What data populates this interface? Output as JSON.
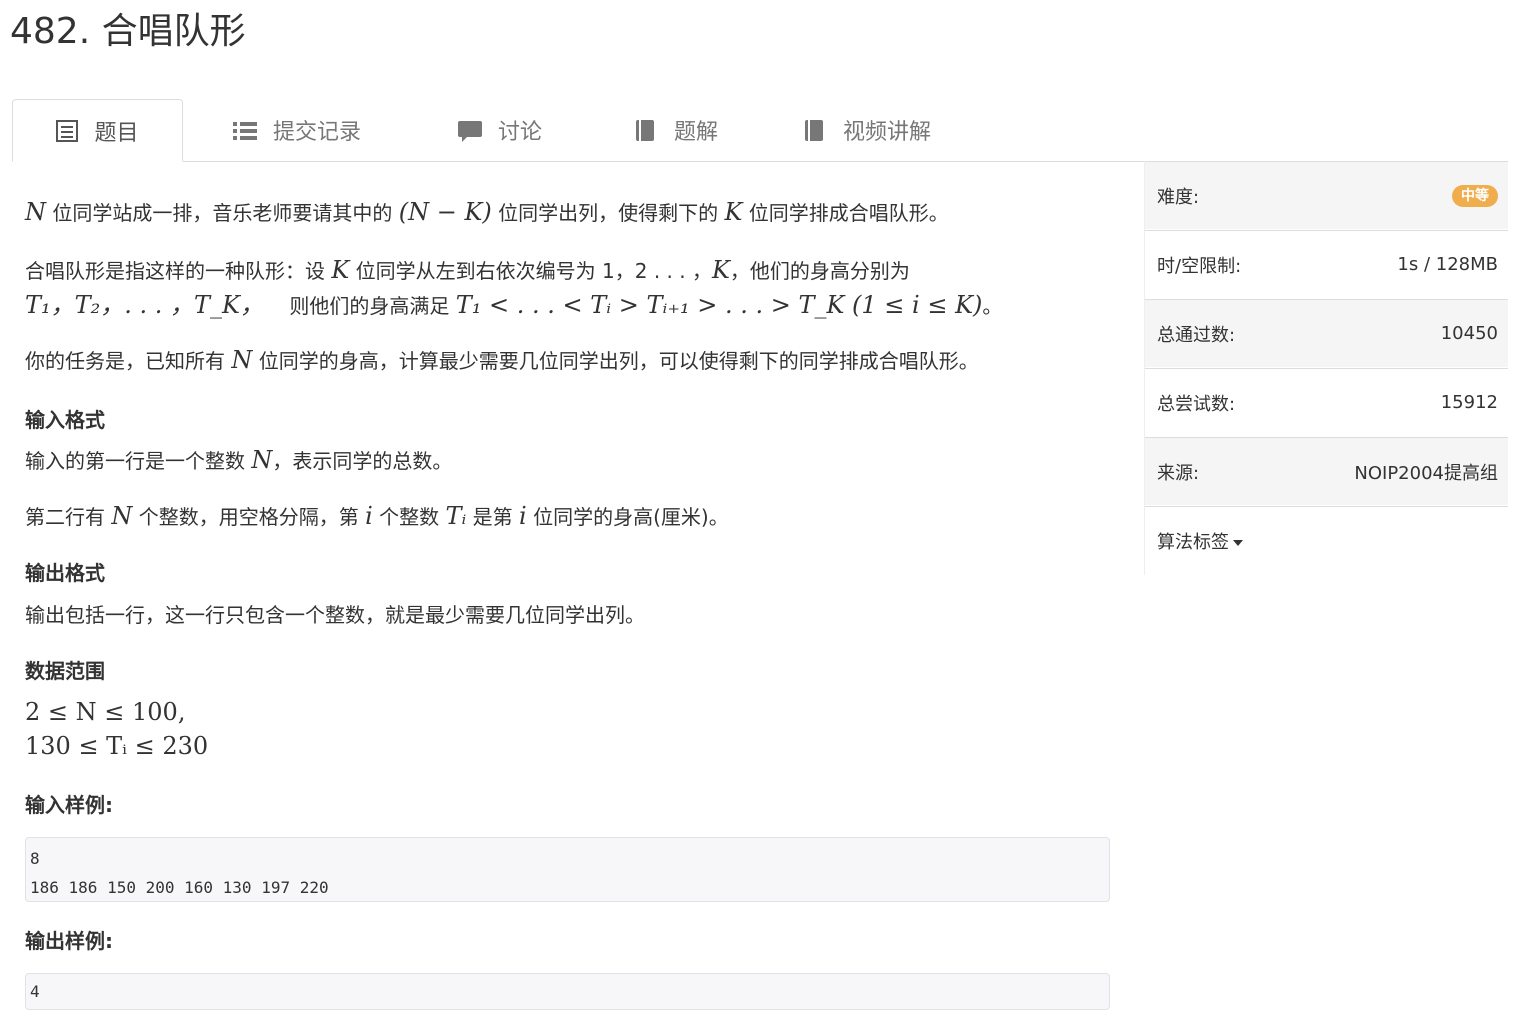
{
  "title": "482. 合唱队形",
  "tabs": [
    {
      "label": "题目",
      "icon": "document-icon",
      "active": true
    },
    {
      "label": "提交记录",
      "icon": "list-icon"
    },
    {
      "label": "讨论",
      "icon": "comment-icon"
    },
    {
      "label": "题解",
      "icon": "book-icon"
    },
    {
      "label": "视频讲解",
      "icon": "book-icon"
    }
  ],
  "problem": {
    "p1_a": "N",
    "p1_b": " 位同学站成一排，音乐老师要请其中的 ",
    "p1_c": "(N − K)",
    "p1_d": " 位同学出列，使得剩下的 ",
    "p1_e": "K",
    "p1_f": " 位同学排成合唱队形。",
    "p2_a": "合唱队形是指这样的一种队形：设 ",
    "p2_b": "K",
    "p2_c": " 位同学从左到右依次编号为 1，2 . . . ，",
    "p2_d": "K",
    "p2_e": "，他们的身高分别为",
    "p2_f": "T₁，T₂，. . . ，T_K，",
    "p2_g": "则他们的身高满足 ",
    "p2_h": "T₁ < . . . < Tᵢ > Tᵢ₊₁ > . . . > T_K (1 ≤ i ≤ K)",
    "p2_i": "。",
    "p3_a": "你的任务是，已知所有 ",
    "p3_b": "N",
    "p3_c": " 位同学的身高，计算最少需要几位同学出列，可以使得剩下的同学排成合唱队形。",
    "input_heading": "输入格式",
    "input_l1_a": "输入的第一行是一个整数 ",
    "input_l1_b": "N",
    "input_l1_c": "，表示同学的总数。",
    "input_l2_a": "第二行有 ",
    "input_l2_b": "N",
    "input_l2_c": " 个整数，用空格分隔，第 ",
    "input_l2_d": "i",
    "input_l2_e": " 个整数 ",
    "input_l2_f": "Tᵢ",
    "input_l2_g": " 是第 ",
    "input_l2_h": "i",
    "input_l2_i": " 位同学的身高(厘米)。",
    "output_heading": "输出格式",
    "output_text": "输出包括一行，这一行只包含一个整数，就是最少需要几位同学出列。",
    "range_heading": "数据范围",
    "range_1": "2 ≤ N ≤ 100,",
    "range_2": "130 ≤ Tᵢ ≤ 230",
    "sample_in_heading": "输入样例:",
    "sample_in": "8\n186 186 150 200 160 130 197 220",
    "sample_out_heading": "输出样例:",
    "sample_out": "4"
  },
  "sidebar": {
    "difficulty_label": "难度:",
    "difficulty_value": "中等",
    "limit_label": "时/空限制:",
    "limit_value": "1s / 128MB",
    "passed_label": "总通过数:",
    "passed_value": "10450",
    "tries_label": "总尝试数:",
    "tries_value": "15912",
    "source_label": "来源:",
    "source_value": "NOIP2004提高组",
    "tags_label": "算法标签"
  },
  "colors": {
    "badge": "#f0ad4e",
    "code_bg": "#f7f7f9",
    "sidebar_gray": "#f5f5f5"
  }
}
